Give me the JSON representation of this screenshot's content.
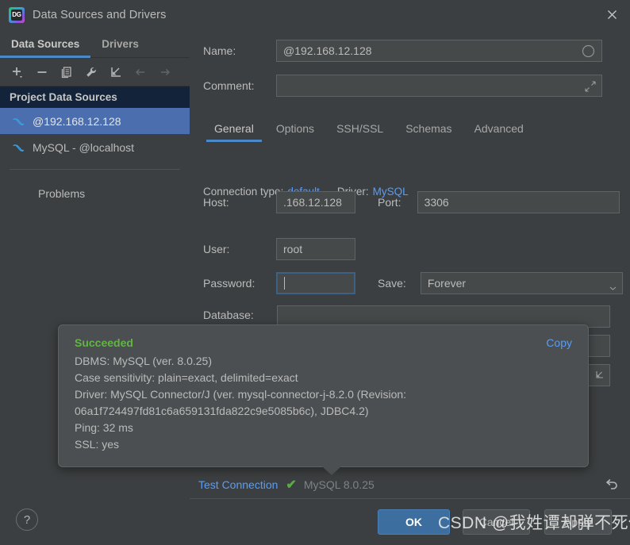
{
  "window": {
    "title": "Data Sources and Drivers",
    "logo_text": "DG",
    "close_label": "×"
  },
  "left_panel": {
    "tabs": [
      {
        "label": "Data Sources",
        "active": true
      },
      {
        "label": "Drivers",
        "active": false
      }
    ],
    "toolbar": [
      {
        "name": "add-button",
        "icon": "plus-icon",
        "disabled": false
      },
      {
        "name": "remove-button",
        "icon": "minus-icon",
        "disabled": false
      },
      {
        "name": "duplicate-button",
        "icon": "copy-icon",
        "disabled": false
      },
      {
        "name": "properties-button",
        "icon": "wrench-icon",
        "disabled": false
      },
      {
        "name": "import-button",
        "icon": "import-arrow-icon",
        "disabled": false
      },
      {
        "name": "back-button",
        "icon": "arrow-left-icon",
        "disabled": true
      },
      {
        "name": "forward-button",
        "icon": "arrow-right-icon",
        "disabled": true
      }
    ],
    "group_header": "Project Data Sources",
    "items": [
      {
        "label": "@192.168.12.128",
        "icon": "mysql-dolphin-icon",
        "selected": true
      },
      {
        "label": "MySQL - @localhost",
        "icon": "mysql-dolphin-icon",
        "selected": false
      }
    ],
    "problems_label": "Problems"
  },
  "form": {
    "name_label": "Name:",
    "name_value": "@192.168.12.128",
    "comment_label": "Comment:",
    "comment_value": "",
    "tabs": [
      {
        "label": "General",
        "active": true
      },
      {
        "label": "Options",
        "active": false
      },
      {
        "label": "SSH/SSL",
        "active": false
      },
      {
        "label": "Schemas",
        "active": false
      },
      {
        "label": "Advanced",
        "active": false
      }
    ],
    "connection_type_label": "Connection type:",
    "connection_type_value": "default",
    "driver_label": "Driver:",
    "driver_value": "MySQL",
    "host_label": "Host:",
    "host_value": ".168.12.128",
    "port_label": "Port:",
    "port_value": "3306",
    "user_label": "User:",
    "user_value": "root",
    "password_label": "Password:",
    "password_value": "",
    "save_label": "Save:",
    "save_value": "Forever",
    "database_label": "Database:",
    "database_value": ""
  },
  "balloon": {
    "status": "Succeeded",
    "copy_label": "Copy",
    "lines": [
      "DBMS: MySQL (ver. 8.0.25)",
      "Case sensitivity: plain=exact, delimited=exact",
      "Driver: MySQL Connector/J (ver. mysql-connector-j-8.2.0 (Revision:",
      "06a1f724497fd81c6a659131fda822c9e5085b6c), JDBC4.2)",
      "Ping: 32 ms",
      "SSL: yes"
    ]
  },
  "status_bar": {
    "test_connection_label": "Test Connection",
    "check_glyph": "✔",
    "version_label": "MySQL 8.0.25"
  },
  "footer": {
    "help_label": "?",
    "ok_label": "OK",
    "cancel_label": "Cancel",
    "apply_label": "Apply"
  },
  "watermark": "CSDN @我姓谭却弹不死你",
  "colors": {
    "background": "#3c3f41",
    "accent_blue": "#4a88c7",
    "link_blue": "#589df6",
    "selection_blue": "#4b6eaf",
    "success_green": "#62b543",
    "header_navy": "#13243a",
    "field_bg": "#45494a",
    "primary_button": "#3c6ea0"
  }
}
